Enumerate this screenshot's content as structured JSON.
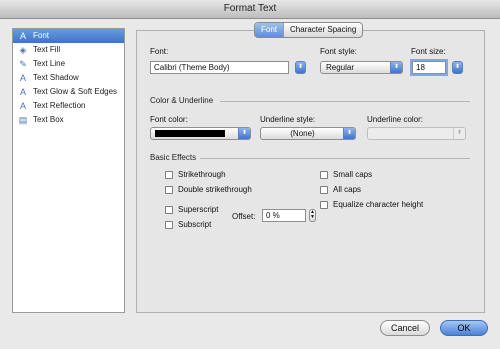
{
  "window": {
    "title": "Format Text"
  },
  "sidebar": {
    "items": [
      {
        "label": "Font",
        "icon": "A",
        "icon_name": "font-icon"
      },
      {
        "label": "Text Fill",
        "icon": "◈",
        "icon_name": "paint-bucket-icon"
      },
      {
        "label": "Text Line",
        "icon": "✎",
        "icon_name": "pen-icon"
      },
      {
        "label": "Text Shadow",
        "icon": "A",
        "icon_name": "text-shadow-icon"
      },
      {
        "label": "Text Glow & Soft Edges",
        "icon": "A",
        "icon_name": "text-glow-icon"
      },
      {
        "label": "Text Reflection",
        "icon": "A",
        "icon_name": "text-reflection-icon"
      },
      {
        "label": "Text Box",
        "icon": "▤",
        "icon_name": "text-box-icon"
      }
    ]
  },
  "tabs": {
    "font": "Font",
    "spacing": "Character Spacing"
  },
  "font": {
    "font_label": "Font:",
    "font_value": "Calibri (Theme Body)",
    "style_label": "Font style:",
    "style_value": "Regular",
    "size_label": "Font size:",
    "size_value": "18"
  },
  "color_underline": {
    "section": "Color & Underline",
    "font_color_label": "Font color:",
    "underline_style_label": "Underline style:",
    "underline_style_value": "(None)",
    "underline_color_label": "Underline color:"
  },
  "effects": {
    "section": "Basic Effects",
    "strikethrough": "Strikethrough",
    "double_strikethrough": "Double strikethrough",
    "superscript": "Superscript",
    "subscript": "Subscript",
    "offset_label": "Offset:",
    "offset_value": "0 %",
    "small_caps": "Small caps",
    "all_caps": "All caps",
    "equalize": "Equalize character height"
  },
  "buttons": {
    "cancel": "Cancel",
    "ok": "OK"
  },
  "colors": {
    "accent": "#3d73c9",
    "font_color": "#000000"
  },
  "icons": {
    "arrow_updown": "⬍",
    "arrow_down": "▼"
  }
}
